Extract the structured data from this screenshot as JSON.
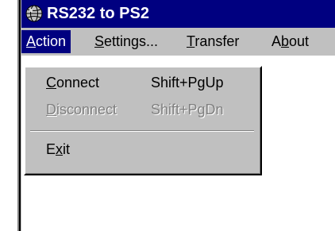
{
  "window": {
    "title": "RS232 to PS2",
    "icon": "globe-icon"
  },
  "menubar": {
    "items": [
      {
        "pre": "",
        "mn": "A",
        "post": "ction",
        "active": true
      },
      {
        "pre": "",
        "mn": "S",
        "post": "ettings...",
        "active": false
      },
      {
        "pre": "",
        "mn": "T",
        "post": "ransfer",
        "active": false
      },
      {
        "pre": "A",
        "mn": "b",
        "post": "out",
        "active": false
      }
    ]
  },
  "dropdown": {
    "items": [
      {
        "pre": "",
        "mn": "C",
        "post": "onnect",
        "shortcut": "Shift+PgUp",
        "enabled": true
      },
      {
        "pre": "",
        "mn": "D",
        "post": "isconnect",
        "shortcut": "Shift+PgDn",
        "enabled": false
      },
      {
        "pre": "E",
        "mn": "x",
        "post": "it",
        "shortcut": "",
        "enabled": true
      }
    ]
  },
  "colors": {
    "titlebar": "#000080",
    "menu_face": "#c0c0c0",
    "highlight": "#000080",
    "disabled_text": "#808080"
  }
}
